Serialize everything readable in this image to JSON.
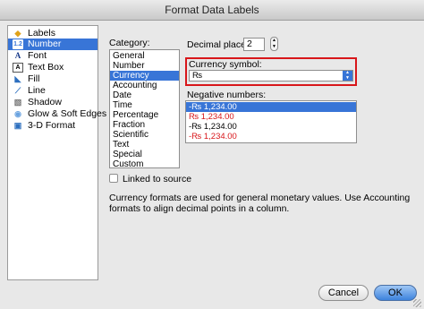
{
  "window": {
    "title": "Format Data Labels"
  },
  "sidebar": {
    "items": [
      {
        "label": "Labels",
        "icon": "tag-icon",
        "selected": false
      },
      {
        "label": "Number",
        "icon": "number-icon",
        "selected": true
      },
      {
        "label": "Font",
        "icon": "font-icon",
        "selected": false
      },
      {
        "label": "Text Box",
        "icon": "text-box-icon",
        "selected": false
      },
      {
        "label": "Fill",
        "icon": "fill-bucket-icon",
        "selected": false
      },
      {
        "label": "Line",
        "icon": "line-icon",
        "selected": false
      },
      {
        "label": "Shadow",
        "icon": "shadow-icon",
        "selected": false
      },
      {
        "label": "Glow & Soft Edges",
        "icon": "glow-icon",
        "selected": false
      },
      {
        "label": "3-D Format",
        "icon": "3d-format-icon",
        "selected": false
      }
    ]
  },
  "category": {
    "label": "Category:",
    "items": [
      "General",
      "Number",
      "Currency",
      "Accounting",
      "Date",
      "Time",
      "Percentage",
      "Fraction",
      "Scientific",
      "Text",
      "Special",
      "Custom"
    ],
    "selected": "Currency"
  },
  "decimal": {
    "label": "Decimal places:",
    "value": "2"
  },
  "currency": {
    "label": "Currency symbol:",
    "value": "₨"
  },
  "negative": {
    "label": "Negative numbers:",
    "items": [
      {
        "text": "-₨ 1,234.00",
        "color": "#000000",
        "selected": true
      },
      {
        "text": "₨ 1,234.00",
        "color": "#d8161a",
        "selected": false
      },
      {
        "text": "-₨ 1,234.00",
        "color": "#000000",
        "selected": false
      },
      {
        "text": "-₨ 1,234.00",
        "color": "#d8161a",
        "selected": false
      }
    ]
  },
  "linked": {
    "label": "Linked to source",
    "checked": false
  },
  "description": "Currency formats are used for general monetary values.  Use Accounting formats to align decimal points in a column.",
  "buttons": {
    "cancel": "Cancel",
    "ok": "OK"
  },
  "colors": {
    "accent": "#3875d7",
    "highlight": "#d8161a",
    "negative_red": "#d8161a"
  }
}
